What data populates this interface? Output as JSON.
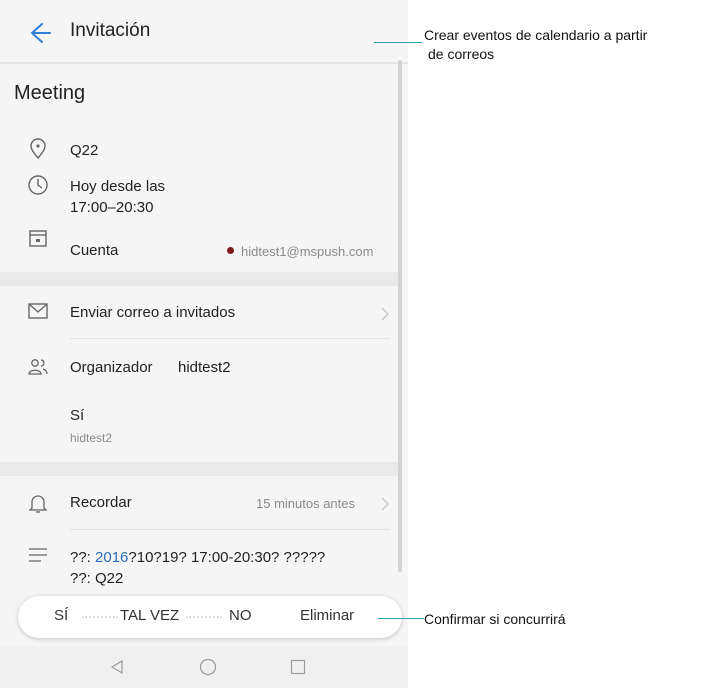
{
  "app_bar": {
    "title": "Invitación"
  },
  "event": {
    "title": "Meeting",
    "location": "Q22",
    "time_line1": "Hoy desde las",
    "time_line2": "17:00–20:30",
    "account_label": "Cuenta",
    "account_value": "hidtest1@mspush.com",
    "account_dot_color": "#7a1a1a"
  },
  "guests": {
    "email_label": "Enviar correo a invitados",
    "organizer_label": "Organizador",
    "organizer_name": "hidtest2",
    "response": "Sí",
    "response_user": "hidtest2"
  },
  "reminder": {
    "label": "Recordar",
    "value": "15 minutos antes"
  },
  "notes": {
    "line1_prefix": "??: ",
    "line1_year": "2016",
    "line1_rest": "?10?19? 17:00-20:30? ?????",
    "line2": "??: Q22",
    "link_color": "#2b6fb8"
  },
  "actions": {
    "yes": "SÍ",
    "maybe": "TAL VEZ",
    "no": "NO",
    "delete": "Eliminar"
  },
  "icons": {
    "back": "arrow-left-icon",
    "location": "map-pin-icon",
    "time": "clock-icon",
    "account": "calendar-icon",
    "email": "envelope-icon",
    "people": "people-icon",
    "bell": "bell-icon",
    "notes": "lines-icon",
    "nav_back": "triangle-back-icon",
    "nav_home": "circle-home-icon",
    "nav_recent": "square-recent-icon"
  },
  "callouts": {
    "top_line1": "Crear eventos de calendario a partir",
    "top_line2": "de correos",
    "bottom": "Confirmar si concurrirá"
  },
  "accent_color": "#2f7fd8",
  "callout_line_color": "#2aa6a6"
}
